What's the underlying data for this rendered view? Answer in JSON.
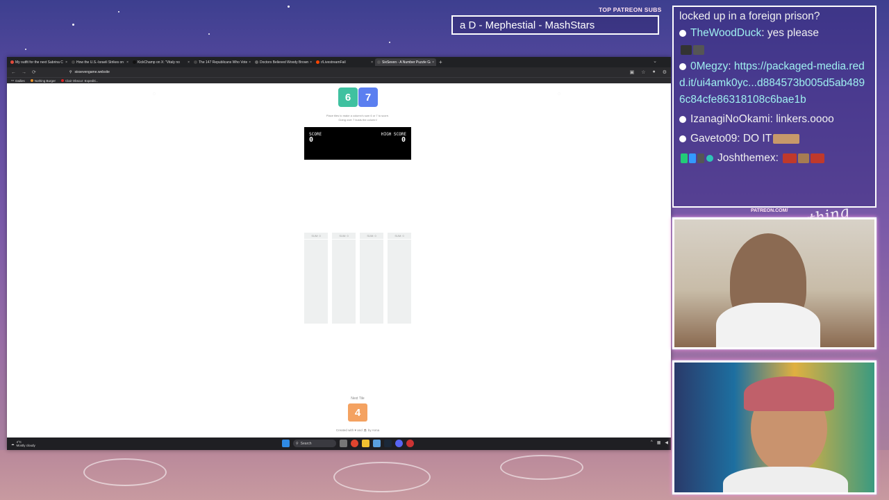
{
  "overlay": {
    "patreon_title": "TOP PATREON SUBS",
    "subs_text": "a D - Mephestial - MashStars",
    "cam_label": "PATREON.COM/",
    "cam_script": "Anything Else"
  },
  "chat": {
    "top_line": "locked up in a foreign prison?",
    "messages": [
      {
        "user": "TheWoodDuck",
        "text": "yes please"
      },
      {
        "user": "0Megzy",
        "text": "https://packaged-media.redd.it/ui4amk0yc...d884573b005d5ab4896c84cfe86318108c6bae1b"
      },
      {
        "user": "IzanagiNoOkami",
        "text": "linkers.oooo"
      },
      {
        "user": "Gaveto09",
        "text": "DO IT"
      },
      {
        "user": "Joshthemex",
        "text": ""
      }
    ]
  },
  "browser": {
    "tabs": [
      {
        "title": "My outfit for the next Sabrina C",
        "color": "#e14a3b"
      },
      {
        "title": "How the U.S.-Israeli Strikes on I",
        "color": "#444"
      },
      {
        "title": "KickChamp on X: \"Vitaly no",
        "color": "#111"
      },
      {
        "title": "The 147 Republicans Who Voted",
        "color": "#444"
      },
      {
        "title": "Doctors Believed Woody Brown",
        "color": "#666"
      },
      {
        "title": "r/LivestreamFail",
        "color": "#ff4500"
      },
      {
        "title": "SixSeven - A Number Puzzle Ga",
        "color": "#555",
        "active": true
      }
    ],
    "url": "sixsevengame.website",
    "bookmarks": [
      "Dailies",
      "Nothing Burger",
      "Clair Obscur: Expediti..."
    ]
  },
  "game": {
    "logo_left": "6",
    "logo_right": "7",
    "logo_left_color": "#3fc1a0",
    "logo_right_color": "#5b7ff0",
    "instructions_line1": "Place tiles to make a column's sum 6 or 7 to score.",
    "instructions_line2": "Going over 7 busts the column!",
    "score_label": "SCORE",
    "score_value": "0",
    "high_score_label": "HIGH SCORE",
    "high_score_value": "0",
    "columns": [
      "SUM: 0",
      "SUM: 0",
      "SUM: 0",
      "SUM: 0"
    ],
    "next_label": "Next Tile",
    "next_value": "4",
    "next_color": "#f4a261",
    "credit": "Created with ♥ and ☕ by Anna"
  },
  "taskbar": {
    "temp": "4°C",
    "weather": "Mostly cloudy",
    "search": "Search"
  }
}
